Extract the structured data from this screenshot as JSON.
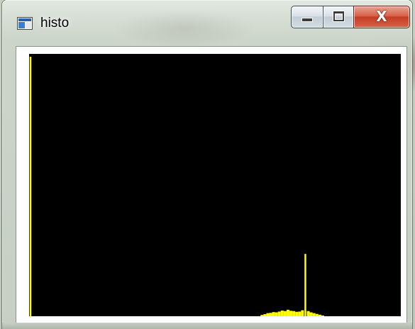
{
  "window": {
    "title": "histo",
    "icon": "app-window-icon",
    "buttons": {
      "minimize": {
        "icon": "minimize-icon"
      },
      "maximize": {
        "icon": "maximize-icon"
      },
      "close": {
        "icon": "close-icon",
        "label": "X"
      }
    }
  },
  "colors": {
    "plot_background": "#000000",
    "histogram": "#ffff00",
    "close_button": "#c7452c"
  },
  "chart_data": {
    "type": "bar",
    "title": "",
    "xlabel": "",
    "ylabel": "",
    "xlim": [
      0,
      255
    ],
    "ylim": [
      0,
      100
    ],
    "grid": false,
    "legend": "none",
    "series": [
      {
        "values": [
          {
            "x": 0,
            "y": 100
          },
          {
            "x": 160,
            "y": 0.5
          },
          {
            "x": 162,
            "y": 0.8
          },
          {
            "x": 164,
            "y": 1.2
          },
          {
            "x": 166,
            "y": 1.3
          },
          {
            "x": 168,
            "y": 1.6
          },
          {
            "x": 170,
            "y": 1.5
          },
          {
            "x": 172,
            "y": 1.8
          },
          {
            "x": 174,
            "y": 2.2
          },
          {
            "x": 176,
            "y": 2.0
          },
          {
            "x": 178,
            "y": 2.5
          },
          {
            "x": 180,
            "y": 2.1
          },
          {
            "x": 182,
            "y": 2.0
          },
          {
            "x": 184,
            "y": 1.7
          },
          {
            "x": 186,
            "y": 1.8
          },
          {
            "x": 188,
            "y": 2.3
          },
          {
            "x": 190,
            "y": 24
          },
          {
            "x": 192,
            "y": 2.0
          },
          {
            "x": 194,
            "y": 1.5
          },
          {
            "x": 196,
            "y": 1.2
          },
          {
            "x": 198,
            "y": 0.9
          },
          {
            "x": 200,
            "y": 0.6
          },
          {
            "x": 202,
            "y": 0.3
          }
        ]
      }
    ]
  }
}
